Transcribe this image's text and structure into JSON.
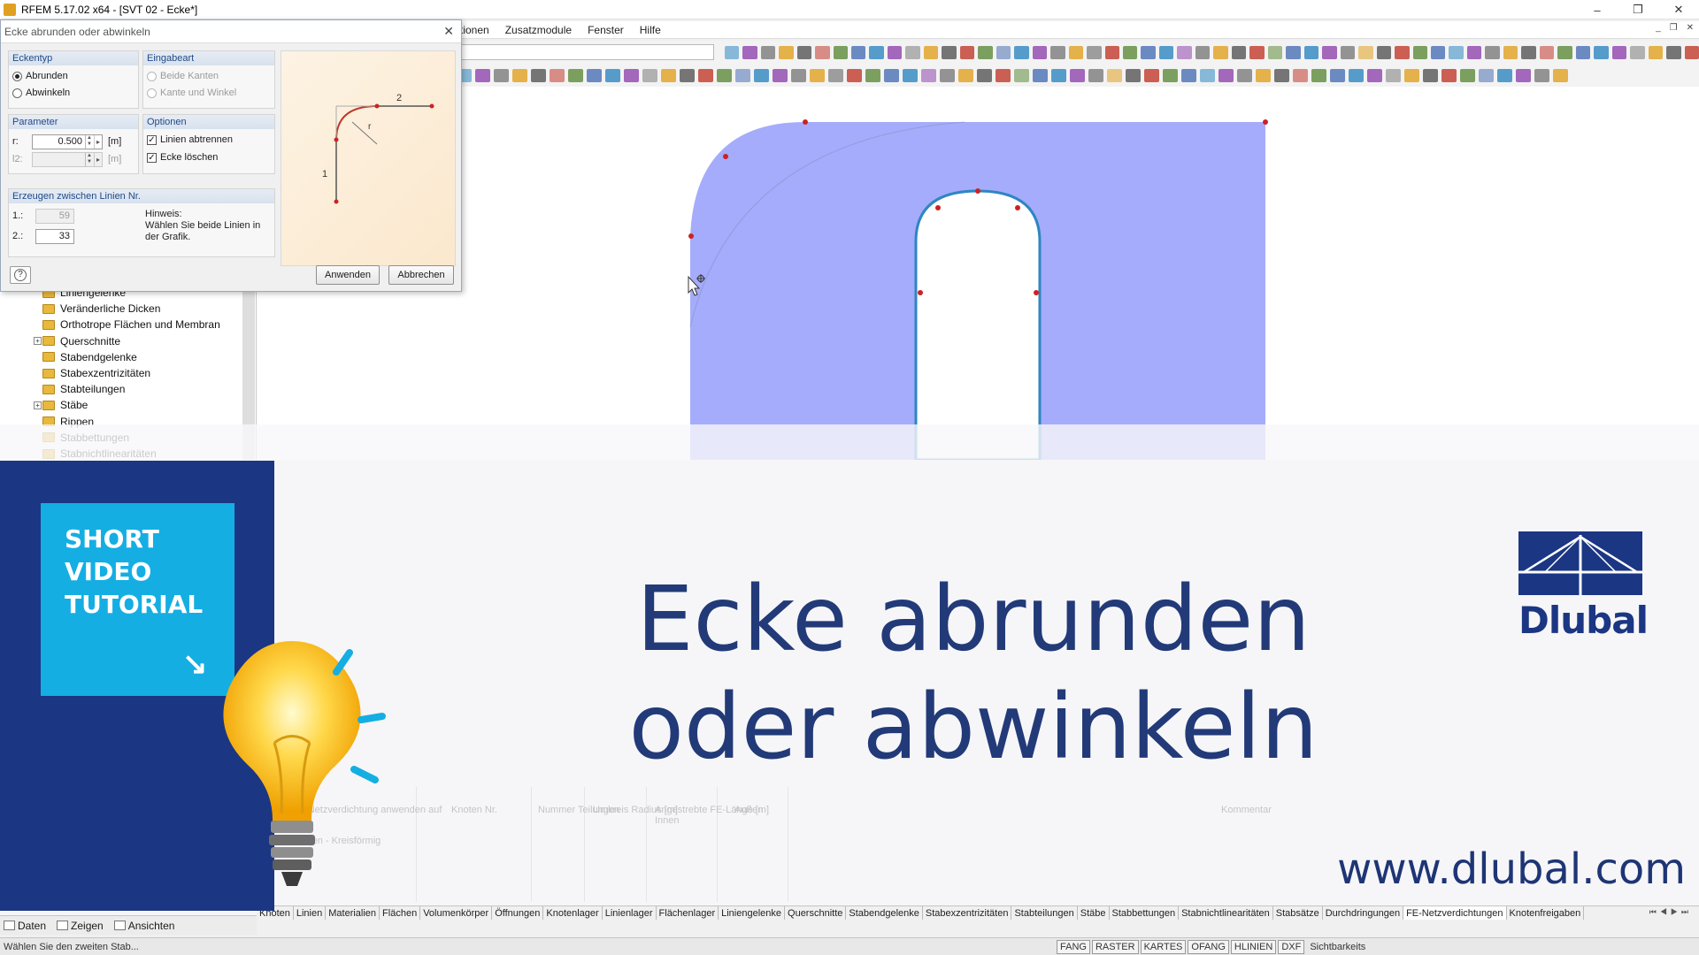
{
  "window": {
    "title": "RFEM 5.17.02 x64 - [SVT 02 - Ecke*]",
    "controls": [
      "–",
      "❐",
      "✕"
    ],
    "mdi_controls": [
      "_",
      "❐",
      "✕"
    ]
  },
  "menu": [
    "tionen",
    "Zusatzmodule",
    "Fenster",
    "Hilfe"
  ],
  "dialog": {
    "title": "Ecke abrunden oder abwinkeln",
    "close": "✕",
    "eckentyp": {
      "header": "Eckentyp",
      "options": [
        "Abrunden",
        "Abwinkeln"
      ],
      "selected": "Abrunden"
    },
    "eingabeart": {
      "header": "Eingabeart",
      "options": [
        "Beide Kanten",
        "Kante und Winkel"
      ]
    },
    "parameter": {
      "header": "Parameter",
      "r_label": "r:",
      "r_value": "0.500",
      "r_unit": "[m]",
      "l2_label": "l2:",
      "l2_value": "",
      "l2_unit": "[m]"
    },
    "optionen": {
      "header": "Optionen",
      "linien_abtrennen": "Linien abtrennen",
      "ecke_loeschen": "Ecke löschen"
    },
    "erzeugen": {
      "header": "Erzeugen zwischen Linien Nr.",
      "line1_label": "1.:",
      "line1_value": "59",
      "line2_label": "2.:",
      "line2_value": "33",
      "hint_title": "Hinweis:",
      "hint_text": "Wählen Sie beide Linien in der Grafik."
    },
    "preview_labels": {
      "l1": "1",
      "l2": "2",
      "r": "r"
    },
    "buttons": {
      "help": "?",
      "apply": "Anwenden",
      "cancel": "Abbrechen"
    }
  },
  "tree": [
    {
      "label": "Liniengelenke",
      "expander": false
    },
    {
      "label": "Veränderliche Dicken",
      "expander": false
    },
    {
      "label": "Orthotrope Flächen und Membran",
      "expander": false
    },
    {
      "label": "Querschnitte",
      "expander": true
    },
    {
      "label": "Stabendgelenke",
      "expander": false
    },
    {
      "label": "Stabexzentrizitäten",
      "expander": false
    },
    {
      "label": "Stabteilungen",
      "expander": false
    },
    {
      "label": "Stäbe",
      "expander": true
    },
    {
      "label": "Rippen",
      "expander": false
    },
    {
      "label": "Stabbettungen",
      "expander": false
    },
    {
      "label": "Stabnichtlinearitäten",
      "expander": false
    }
  ],
  "table_headers": [
    "FE-Netzverdichtung anwenden auf",
    "Knoten Nr.",
    "Nummer Teilungen",
    "Umkreis Radius [m]",
    "Angestrebte FE-Länge [m] Innen",
    "Außen",
    "Kommentar"
  ],
  "table_row": "Knoten - Kreisförmig",
  "bottom_tabs": [
    "Knoten",
    "Linien",
    "Materialien",
    "Flächen",
    "Volumenkörper",
    "Öffnungen",
    "Knotenlager",
    "Linienlager",
    "Flächenlager",
    "Liniengelenke",
    "Querschnitte",
    "Stabendgelenke",
    "Stabexzentrizitäten",
    "Stabteilungen",
    "Stäbe",
    "Stabbettungen",
    "Stabnichtlinearitäten",
    "Stabsätze",
    "Durchdringungen",
    "FE-Netzverdichtungen",
    "Knotenfreigaben"
  ],
  "active_bottom_tab": "FE-Netzverdichtungen",
  "nav_tabs": [
    "Daten",
    "Zeigen",
    "Ansichten"
  ],
  "status": {
    "text": "Wählen Sie den zweiten Stab...",
    "buttons": [
      "FANG",
      "RASTER",
      "KARTES",
      "OFANG",
      "HLINIEN",
      "DXF"
    ],
    "extra": "Sichtbarkeits"
  },
  "overlay": {
    "badge": "SHORT\nVIDEO\nTUTORIAL",
    "badge_arrow": "↘",
    "headline_line1": "Ecke abrunden",
    "headline_line2": "oder abwinkeln",
    "website": "www.dlubal.com",
    "logo_text": "Dlubal"
  },
  "colors": {
    "surface": "#a4acfb",
    "edge": "#2e86c1",
    "banner_blue": "#1b3683",
    "badge_cyan": "#14aee3",
    "headline": "#223a78"
  },
  "icons": [
    "app-icon",
    "help-icon",
    "bulb-icon",
    "dlubal-logo-icon",
    "folder-icon",
    "cursor-icon"
  ]
}
